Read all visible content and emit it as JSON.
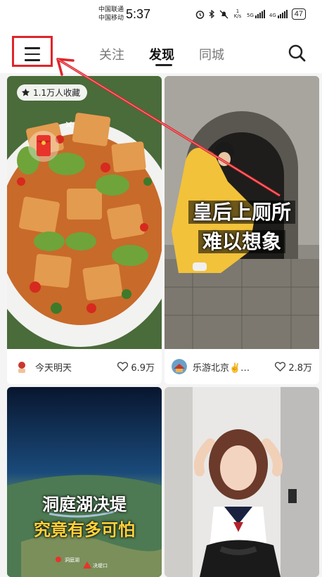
{
  "status": {
    "carrier1": "中国联通",
    "carrier2": "中国移动",
    "time": "5:37",
    "speed": "1 K/s",
    "net1": "5G",
    "net2": "4G",
    "battery": "47"
  },
  "nav": {
    "tabs": [
      {
        "label": "关注"
      },
      {
        "label": "发现"
      },
      {
        "label": "同城"
      }
    ],
    "active_tab": "发现",
    "highlight_color": "#e0252b"
  },
  "feed": {
    "cards": [
      {
        "badge": "1.1万人收藏",
        "author": "今天明天",
        "likes": "6.9万"
      },
      {
        "overlay_line1": "皇后上厕所",
        "overlay_line2": "难以想象",
        "author": "乐游北京✌️…",
        "likes": "2.8万"
      },
      {
        "overlay_line1": "洞庭湖决堤",
        "overlay_line2": "究竟有多可怕",
        "map_label1": "洞庭湖",
        "map_label2": "决堤口"
      },
      {}
    ]
  }
}
